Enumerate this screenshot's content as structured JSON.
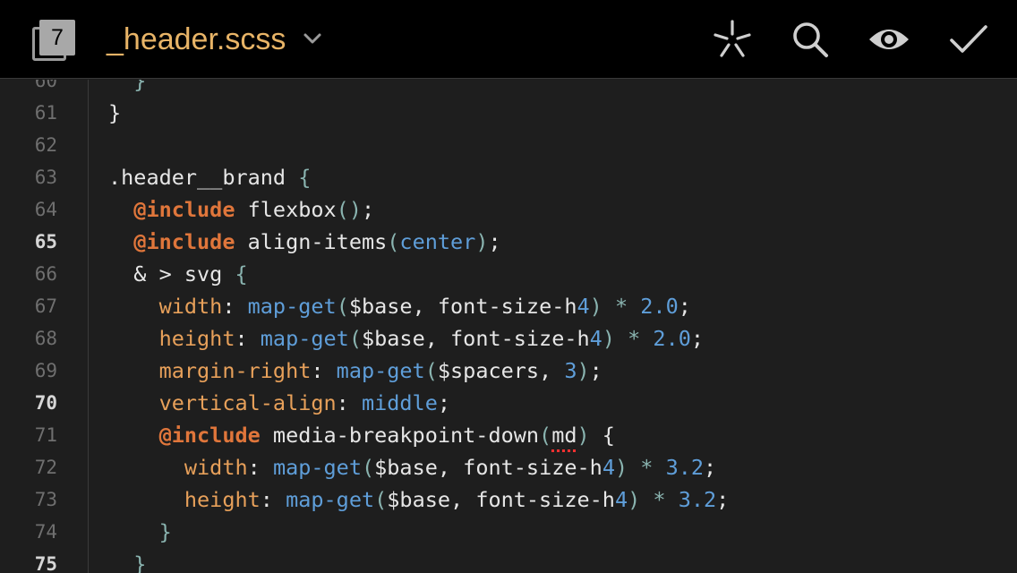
{
  "toolbar": {
    "tabs_count": "7",
    "file_name": "_header.scss",
    "icons": [
      "tabs-icon",
      "chevron-down-icon",
      "sparkle-icon",
      "search-icon",
      "preview-eye-icon",
      "done-check-icon"
    ],
    "colors": {
      "title": "#e8b467",
      "icon": "#9a9a9a",
      "background": "#000000"
    }
  },
  "editor": {
    "colors": {
      "background": "#1e1e1e",
      "keyword": "#e0763b",
      "property": "#e7a05a",
      "function": "#5f9ed9",
      "punctuation": "#8ab4b0",
      "text": "#e6e6e6"
    },
    "lines": [
      {
        "num": "60",
        "bold": false,
        "tokens": [
          {
            "t": "  ",
            "c": ""
          },
          {
            "t": "}",
            "c": "pun"
          }
        ]
      },
      {
        "num": "61",
        "bold": false,
        "tokens": [
          {
            "t": "}",
            "c": ""
          }
        ]
      },
      {
        "num": "62",
        "bold": false,
        "tokens": []
      },
      {
        "num": "63",
        "bold": false,
        "tokens": [
          {
            "t": ".header__brand ",
            "c": ""
          },
          {
            "t": "{",
            "c": "pun"
          }
        ]
      },
      {
        "num": "64",
        "bold": false,
        "tokens": [
          {
            "t": "  ",
            "c": ""
          },
          {
            "t": "@include",
            "c": "kw"
          },
          {
            "t": " flexbox",
            "c": ""
          },
          {
            "t": "()",
            "c": "pun"
          },
          {
            "t": ";",
            "c": ""
          }
        ]
      },
      {
        "num": "65",
        "bold": true,
        "tokens": [
          {
            "t": "  ",
            "c": ""
          },
          {
            "t": "@include",
            "c": "kw"
          },
          {
            "t": " align-items",
            "c": ""
          },
          {
            "t": "(",
            "c": "pun"
          },
          {
            "t": "center",
            "c": "val"
          },
          {
            "t": ")",
            "c": "pun"
          },
          {
            "t": ";",
            "c": ""
          }
        ]
      },
      {
        "num": "66",
        "bold": false,
        "tokens": [
          {
            "t": "  & > svg ",
            "c": ""
          },
          {
            "t": "{",
            "c": "pun"
          }
        ]
      },
      {
        "num": "67",
        "bold": false,
        "tokens": [
          {
            "t": "    ",
            "c": ""
          },
          {
            "t": "width",
            "c": "prop"
          },
          {
            "t": ": ",
            "c": ""
          },
          {
            "t": "map-get",
            "c": "fn"
          },
          {
            "t": "(",
            "c": "pun"
          },
          {
            "t": "$base, font-size-h",
            "c": ""
          },
          {
            "t": "4",
            "c": "num"
          },
          {
            "t": ")",
            "c": "pun"
          },
          {
            "t": " * ",
            "c": "op"
          },
          {
            "t": "2.0",
            "c": "num"
          },
          {
            "t": ";",
            "c": ""
          }
        ]
      },
      {
        "num": "68",
        "bold": false,
        "tokens": [
          {
            "t": "    ",
            "c": ""
          },
          {
            "t": "height",
            "c": "prop"
          },
          {
            "t": ": ",
            "c": ""
          },
          {
            "t": "map-get",
            "c": "fn"
          },
          {
            "t": "(",
            "c": "pun"
          },
          {
            "t": "$base, font-size-h",
            "c": ""
          },
          {
            "t": "4",
            "c": "num"
          },
          {
            "t": ")",
            "c": "pun"
          },
          {
            "t": " * ",
            "c": "op"
          },
          {
            "t": "2.0",
            "c": "num"
          },
          {
            "t": ";",
            "c": ""
          }
        ]
      },
      {
        "num": "69",
        "bold": false,
        "tokens": [
          {
            "t": "    ",
            "c": ""
          },
          {
            "t": "margin-right",
            "c": "prop"
          },
          {
            "t": ": ",
            "c": ""
          },
          {
            "t": "map-get",
            "c": "fn"
          },
          {
            "t": "(",
            "c": "pun"
          },
          {
            "t": "$spacers, ",
            "c": ""
          },
          {
            "t": "3",
            "c": "num"
          },
          {
            "t": ")",
            "c": "pun"
          },
          {
            "t": ";",
            "c": ""
          }
        ]
      },
      {
        "num": "70",
        "bold": true,
        "tokens": [
          {
            "t": "    ",
            "c": ""
          },
          {
            "t": "vertical-align",
            "c": "prop"
          },
          {
            "t": ": ",
            "c": ""
          },
          {
            "t": "middle",
            "c": "val"
          },
          {
            "t": ";",
            "c": ""
          }
        ]
      },
      {
        "num": "71",
        "bold": false,
        "tokens": [
          {
            "t": "    ",
            "c": ""
          },
          {
            "t": "@include",
            "c": "kw"
          },
          {
            "t": " media-breakpoint-down",
            "c": ""
          },
          {
            "t": "(",
            "c": "pun"
          },
          {
            "t": "md",
            "c": "err"
          },
          {
            "t": ")",
            "c": "pun"
          },
          {
            "t": " {",
            "c": ""
          }
        ]
      },
      {
        "num": "72",
        "bold": false,
        "tokens": [
          {
            "t": "      ",
            "c": ""
          },
          {
            "t": "width",
            "c": "prop"
          },
          {
            "t": ": ",
            "c": ""
          },
          {
            "t": "map-get",
            "c": "fn"
          },
          {
            "t": "(",
            "c": "pun"
          },
          {
            "t": "$base, font-size-h",
            "c": ""
          },
          {
            "t": "4",
            "c": "num"
          },
          {
            "t": ")",
            "c": "pun"
          },
          {
            "t": " * ",
            "c": "op"
          },
          {
            "t": "3.2",
            "c": "num"
          },
          {
            "t": ";",
            "c": ""
          }
        ]
      },
      {
        "num": "73",
        "bold": false,
        "tokens": [
          {
            "t": "      ",
            "c": ""
          },
          {
            "t": "height",
            "c": "prop"
          },
          {
            "t": ": ",
            "c": ""
          },
          {
            "t": "map-get",
            "c": "fn"
          },
          {
            "t": "(",
            "c": "pun"
          },
          {
            "t": "$base, font-size-h",
            "c": ""
          },
          {
            "t": "4",
            "c": "num"
          },
          {
            "t": ")",
            "c": "pun"
          },
          {
            "t": " * ",
            "c": "op"
          },
          {
            "t": "3.2",
            "c": "num"
          },
          {
            "t": ";",
            "c": ""
          }
        ]
      },
      {
        "num": "74",
        "bold": false,
        "tokens": [
          {
            "t": "    ",
            "c": ""
          },
          {
            "t": "}",
            "c": "pun"
          }
        ]
      },
      {
        "num": "75",
        "bold": true,
        "tokens": [
          {
            "t": "  ",
            "c": ""
          },
          {
            "t": "}",
            "c": "pun"
          }
        ]
      }
    ]
  }
}
